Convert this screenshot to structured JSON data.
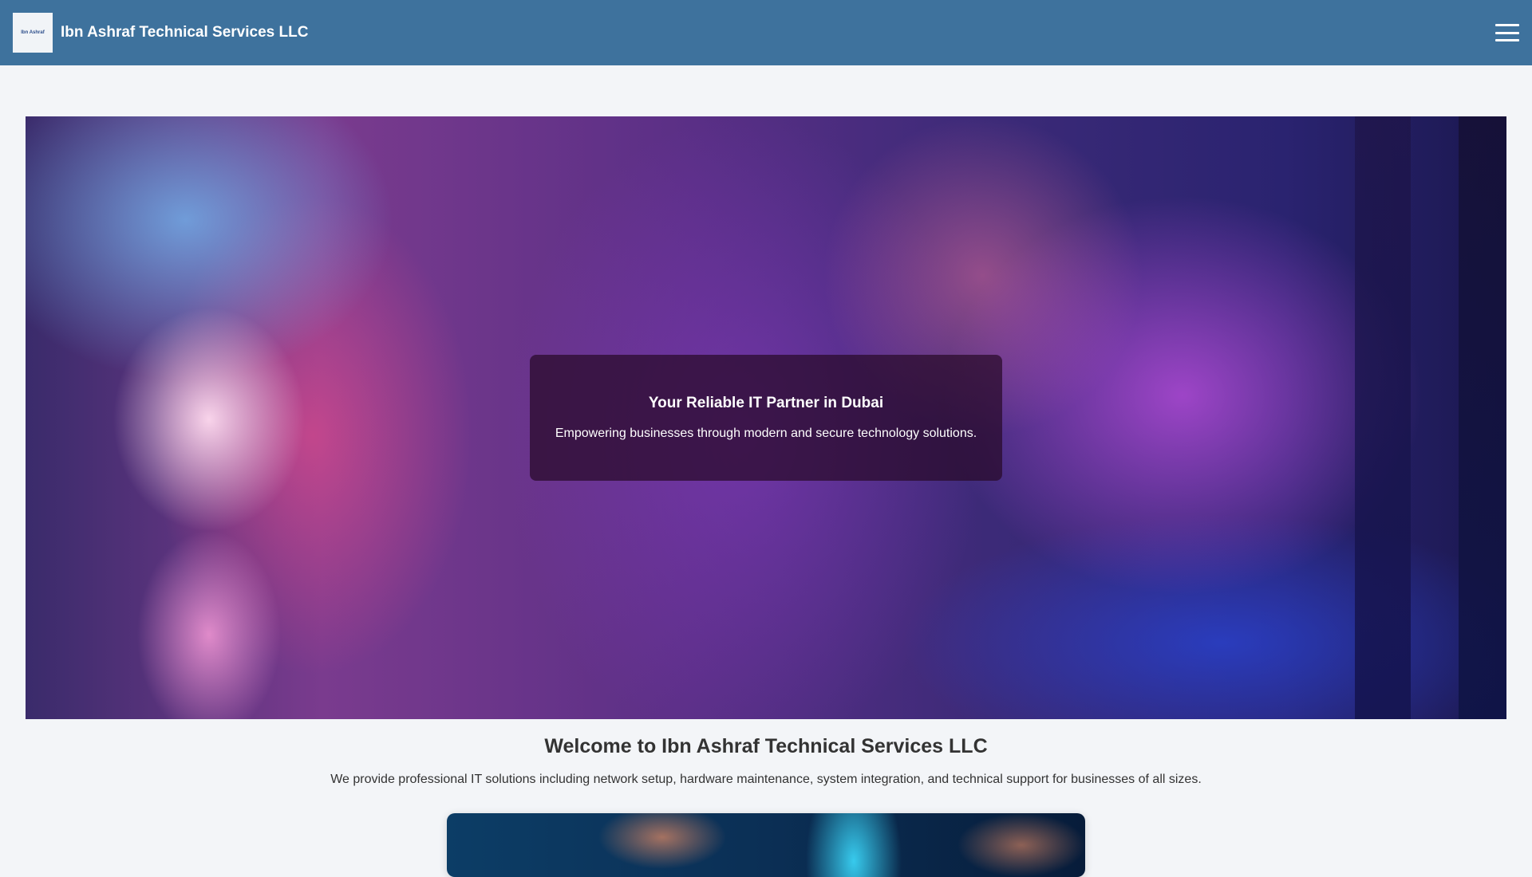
{
  "header": {
    "logo_text": "Ibn Ashraf",
    "title": "Ibn Ashraf Technical Services LLC",
    "menu_icon": "hamburger-icon"
  },
  "hero": {
    "heading": "Your Reliable IT Partner in Dubai",
    "subheading": "Empowering businesses through modern and secure technology solutions."
  },
  "welcome": {
    "heading": "Welcome to Ibn Ashraf Technical Services LLC",
    "text": "We provide professional IT solutions including network setup, hardware maintenance, system integration, and technical support for businesses of all sizes."
  }
}
